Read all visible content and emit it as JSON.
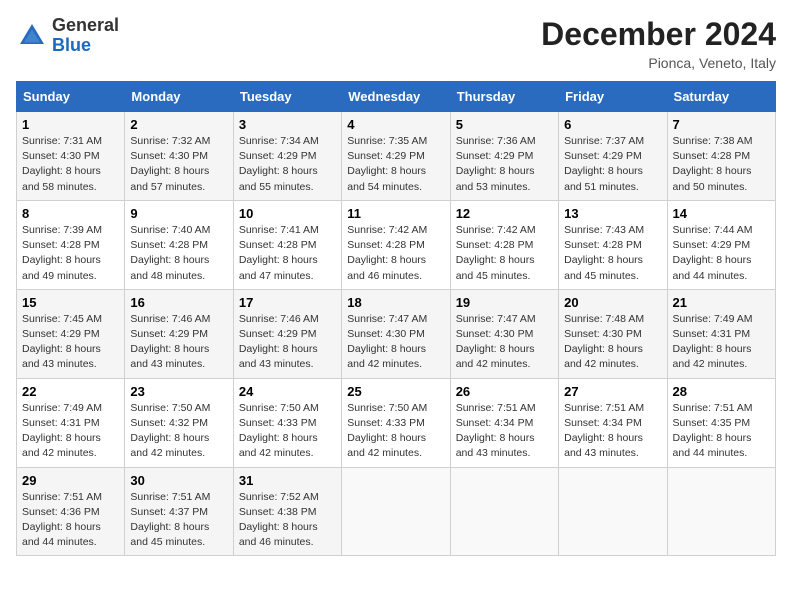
{
  "header": {
    "logo_line1": "General",
    "logo_line2": "Blue",
    "month": "December 2024",
    "location": "Pionca, Veneto, Italy"
  },
  "columns": [
    "Sunday",
    "Monday",
    "Tuesday",
    "Wednesday",
    "Thursday",
    "Friday",
    "Saturday"
  ],
  "weeks": [
    [
      {
        "day": "1",
        "sunrise": "7:31 AM",
        "sunset": "4:30 PM",
        "daylight": "8 hours and 58 minutes."
      },
      {
        "day": "2",
        "sunrise": "7:32 AM",
        "sunset": "4:30 PM",
        "daylight": "8 hours and 57 minutes."
      },
      {
        "day": "3",
        "sunrise": "7:34 AM",
        "sunset": "4:29 PM",
        "daylight": "8 hours and 55 minutes."
      },
      {
        "day": "4",
        "sunrise": "7:35 AM",
        "sunset": "4:29 PM",
        "daylight": "8 hours and 54 minutes."
      },
      {
        "day": "5",
        "sunrise": "7:36 AM",
        "sunset": "4:29 PM",
        "daylight": "8 hours and 53 minutes."
      },
      {
        "day": "6",
        "sunrise": "7:37 AM",
        "sunset": "4:29 PM",
        "daylight": "8 hours and 51 minutes."
      },
      {
        "day": "7",
        "sunrise": "7:38 AM",
        "sunset": "4:28 PM",
        "daylight": "8 hours and 50 minutes."
      }
    ],
    [
      {
        "day": "8",
        "sunrise": "7:39 AM",
        "sunset": "4:28 PM",
        "daylight": "8 hours and 49 minutes."
      },
      {
        "day": "9",
        "sunrise": "7:40 AM",
        "sunset": "4:28 PM",
        "daylight": "8 hours and 48 minutes."
      },
      {
        "day": "10",
        "sunrise": "7:41 AM",
        "sunset": "4:28 PM",
        "daylight": "8 hours and 47 minutes."
      },
      {
        "day": "11",
        "sunrise": "7:42 AM",
        "sunset": "4:28 PM",
        "daylight": "8 hours and 46 minutes."
      },
      {
        "day": "12",
        "sunrise": "7:42 AM",
        "sunset": "4:28 PM",
        "daylight": "8 hours and 45 minutes."
      },
      {
        "day": "13",
        "sunrise": "7:43 AM",
        "sunset": "4:28 PM",
        "daylight": "8 hours and 45 minutes."
      },
      {
        "day": "14",
        "sunrise": "7:44 AM",
        "sunset": "4:29 PM",
        "daylight": "8 hours and 44 minutes."
      }
    ],
    [
      {
        "day": "15",
        "sunrise": "7:45 AM",
        "sunset": "4:29 PM",
        "daylight": "8 hours and 43 minutes."
      },
      {
        "day": "16",
        "sunrise": "7:46 AM",
        "sunset": "4:29 PM",
        "daylight": "8 hours and 43 minutes."
      },
      {
        "day": "17",
        "sunrise": "7:46 AM",
        "sunset": "4:29 PM",
        "daylight": "8 hours and 43 minutes."
      },
      {
        "day": "18",
        "sunrise": "7:47 AM",
        "sunset": "4:30 PM",
        "daylight": "8 hours and 42 minutes."
      },
      {
        "day": "19",
        "sunrise": "7:47 AM",
        "sunset": "4:30 PM",
        "daylight": "8 hours and 42 minutes."
      },
      {
        "day": "20",
        "sunrise": "7:48 AM",
        "sunset": "4:30 PM",
        "daylight": "8 hours and 42 minutes."
      },
      {
        "day": "21",
        "sunrise": "7:49 AM",
        "sunset": "4:31 PM",
        "daylight": "8 hours and 42 minutes."
      }
    ],
    [
      {
        "day": "22",
        "sunrise": "7:49 AM",
        "sunset": "4:31 PM",
        "daylight": "8 hours and 42 minutes."
      },
      {
        "day": "23",
        "sunrise": "7:50 AM",
        "sunset": "4:32 PM",
        "daylight": "8 hours and 42 minutes."
      },
      {
        "day": "24",
        "sunrise": "7:50 AM",
        "sunset": "4:33 PM",
        "daylight": "8 hours and 42 minutes."
      },
      {
        "day": "25",
        "sunrise": "7:50 AM",
        "sunset": "4:33 PM",
        "daylight": "8 hours and 42 minutes."
      },
      {
        "day": "26",
        "sunrise": "7:51 AM",
        "sunset": "4:34 PM",
        "daylight": "8 hours and 43 minutes."
      },
      {
        "day": "27",
        "sunrise": "7:51 AM",
        "sunset": "4:34 PM",
        "daylight": "8 hours and 43 minutes."
      },
      {
        "day": "28",
        "sunrise": "7:51 AM",
        "sunset": "4:35 PM",
        "daylight": "8 hours and 44 minutes."
      }
    ],
    [
      {
        "day": "29",
        "sunrise": "7:51 AM",
        "sunset": "4:36 PM",
        "daylight": "8 hours and 44 minutes."
      },
      {
        "day": "30",
        "sunrise": "7:51 AM",
        "sunset": "4:37 PM",
        "daylight": "8 hours and 45 minutes."
      },
      {
        "day": "31",
        "sunrise": "7:52 AM",
        "sunset": "4:38 PM",
        "daylight": "8 hours and 46 minutes."
      },
      null,
      null,
      null,
      null
    ]
  ],
  "labels": {
    "sunrise": "Sunrise:",
    "sunset": "Sunset:",
    "daylight": "Daylight:"
  }
}
